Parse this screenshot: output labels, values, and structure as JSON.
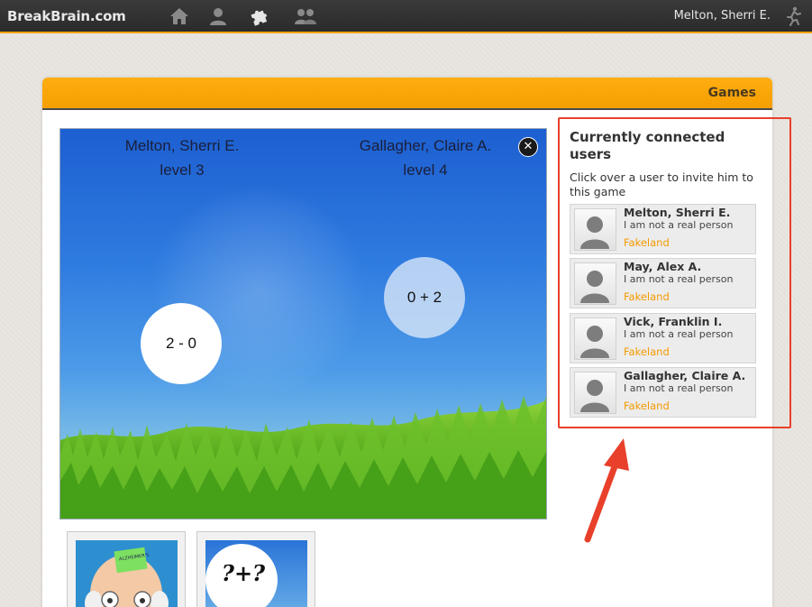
{
  "app": {
    "logo": "BreakBrain.com"
  },
  "topbar": {
    "nav_icons": [
      "home-icon",
      "profile-icon",
      "puzzle-icon",
      "friends-icon"
    ],
    "user_name": "Melton, Sherri E.",
    "logout_icon": "running-man-icon"
  },
  "panel": {
    "title": "Games"
  },
  "game": {
    "player1": {
      "name": "Melton, Sherri E.",
      "level": "level 3"
    },
    "player2": {
      "name": "Gallagher, Claire A.",
      "level": "level 4"
    },
    "close_glyph": "✕",
    "bubble_left": "2 - 0",
    "bubble_right": "0 + 2"
  },
  "thumbnails": [
    {
      "name": "brain-game-thumbnail",
      "note": "ALZHEIMER'S"
    },
    {
      "name": "math-game-thumbnail",
      "text": "?+?"
    }
  ],
  "sidebar": {
    "title": "Currently connected users",
    "hint": "Click over a user to invite him to this game",
    "users": [
      {
        "name": "Melton, Sherri E.",
        "status": "I am not a real person",
        "location": "Fakeland"
      },
      {
        "name": "May, Alex A.",
        "status": "I am not a real person",
        "location": "Fakeland"
      },
      {
        "name": "Vick, Franklin I.",
        "status": "I am not a real person",
        "location": "Fakeland"
      },
      {
        "name": "Gallagher, Claire A.",
        "status": "I am not a real person",
        "location": "Fakeland"
      }
    ]
  },
  "colors": {
    "accent": "#f5a300",
    "annotation": "#e8402a",
    "location_text": "#f39a00"
  }
}
